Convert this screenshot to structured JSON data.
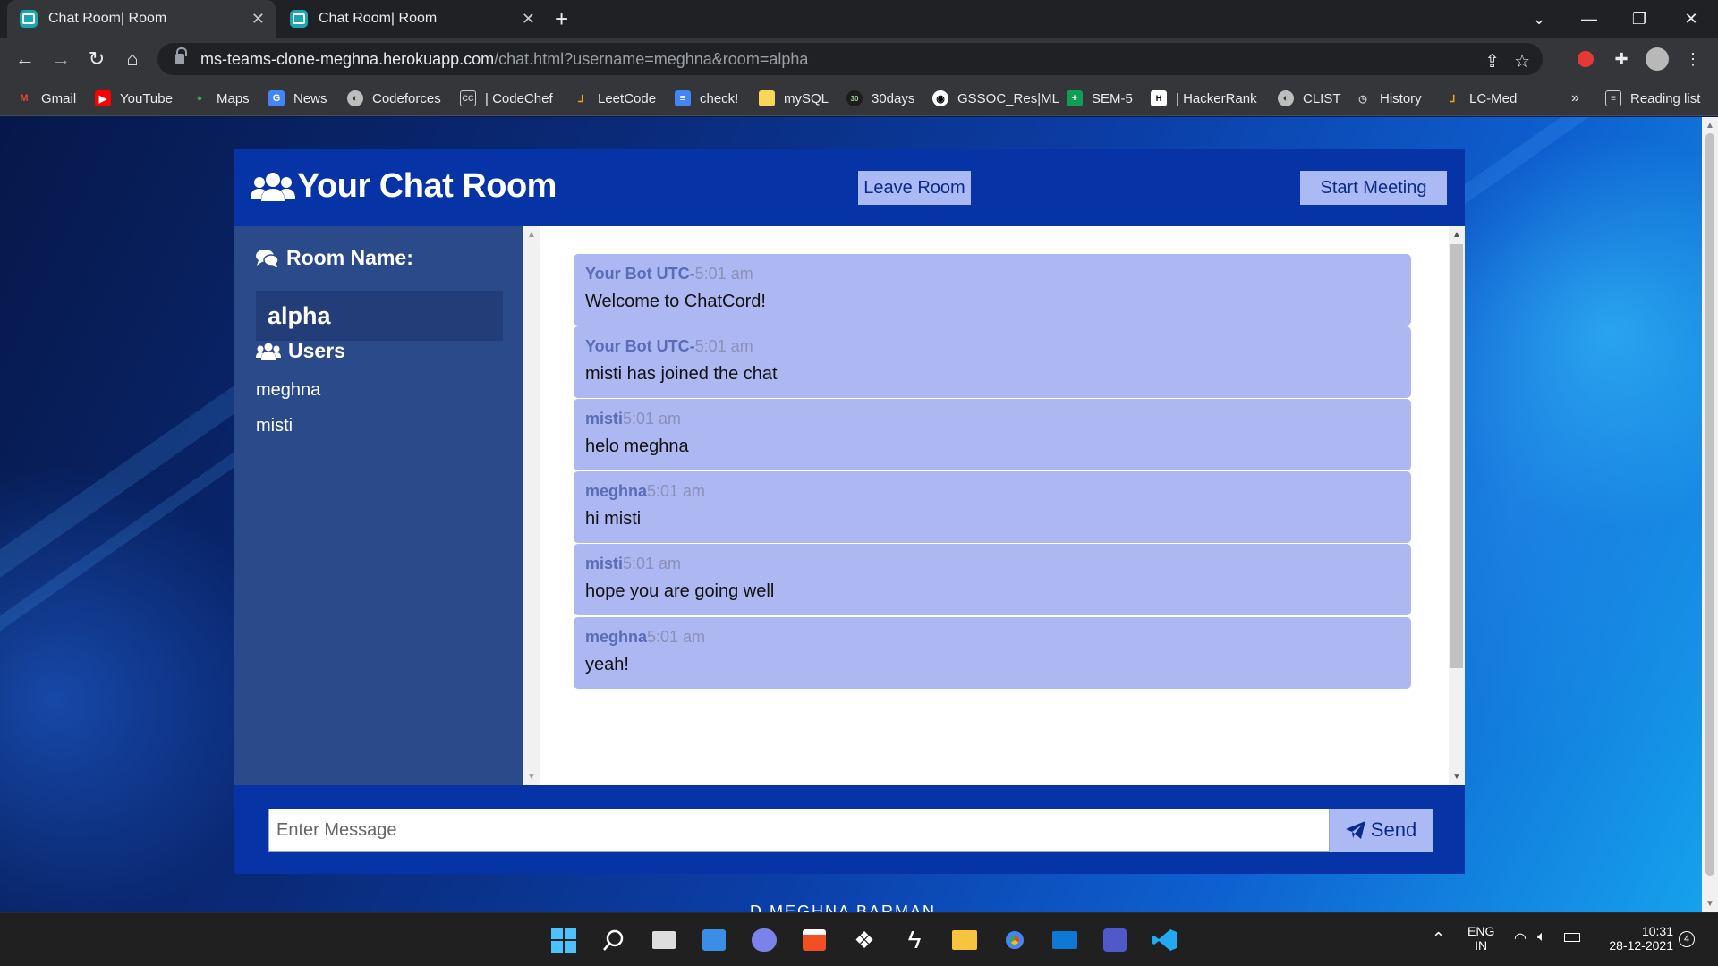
{
  "browser": {
    "tabs": [
      {
        "title": "Chat Room| Room",
        "active": true
      },
      {
        "title": "Chat Room| Room",
        "active": false
      }
    ],
    "url_host": "ms-teams-clone-meghna.herokuapp.com",
    "url_path": "/chat.html?username=meghna&room=alpha",
    "bookmarks": [
      "Gmail",
      "YouTube",
      "Maps",
      "News",
      "Codeforces",
      "| CodeChef",
      "LeetCode",
      "check!",
      "mySQL",
      "30days",
      "GSSOC_Res|ML",
      "SEM-5",
      "| HackerRank",
      "CLIST",
      "History",
      "LC-Med"
    ],
    "more_bookmarks": "»",
    "reading_list": "Reading list"
  },
  "chat": {
    "title": "Your Chat Room",
    "leave_label": "Leave Room",
    "meeting_label": "Start Meeting",
    "room_label": "Room Name:",
    "room_name": "alpha",
    "users_label": "Users",
    "users": [
      "meghna",
      "misti"
    ],
    "messages": [
      {
        "user": "Your Bot UTC-",
        "time": "5:01 am",
        "text": "Welcome to ChatCord!"
      },
      {
        "user": "Your Bot UTC-",
        "time": "5:01 am",
        "text": "misti has joined the chat"
      },
      {
        "user": "misti",
        "time": "5:01 am",
        "text": "helo meghna"
      },
      {
        "user": "meghna",
        "time": "5:01 am",
        "text": "hi misti"
      },
      {
        "user": "misti",
        "time": "5:01 am",
        "text": "hope you are going well"
      },
      {
        "user": "meghna",
        "time": "5:01 am",
        "text": "yeah!"
      }
    ],
    "input_placeholder": "Enter Message",
    "send_label": "Send",
    "footer": "D.MEGHNA BARMAN"
  },
  "taskbar": {
    "language": "ENG",
    "region": "IN",
    "time": "10:31",
    "date": "28-12-2021",
    "notification_count": "4"
  },
  "colors": {
    "header": "#0634a6",
    "sidebar": "#2b4a8a",
    "message_bg": "#adb8f2",
    "button_bg": "#abb9f5"
  }
}
